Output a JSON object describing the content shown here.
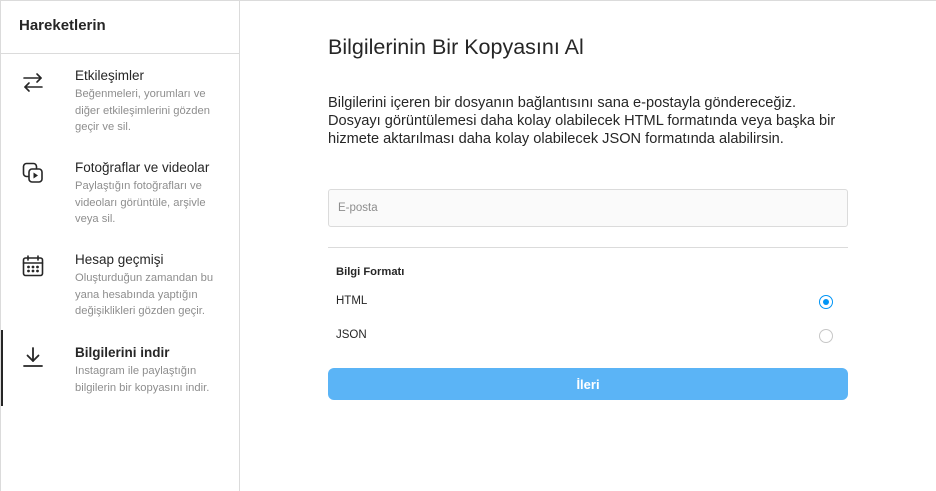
{
  "sidebar": {
    "title": "Hareketlerin",
    "items": [
      {
        "title": "Etkileşimler",
        "desc": "Beğenmeleri, yorumları ve diğer etkileşimlerini gözden geçir ve sil.",
        "icon": "arrows-swap-icon"
      },
      {
        "title": "Fotoğraflar ve videolar",
        "desc": "Paylaştığın fotoğrafları ve videoları görüntüle, arşivle veya sil.",
        "icon": "photo-video-icon"
      },
      {
        "title": "Hesap geçmişi",
        "desc": "Oluşturduğun zamandan bu yana hesabında yaptığın değişiklikleri gözden geçir.",
        "icon": "calendar-icon"
      },
      {
        "title": "Bilgilerini indir",
        "desc": "Instagram ile paylaştığın bilgilerin bir kopyasını indir.",
        "icon": "download-icon",
        "active": true
      }
    ]
  },
  "main": {
    "title": "Bilgilerinin Bir Kopyasını Al",
    "description": "Bilgilerini içeren bir dosyanın bağlantısını sana e-postayla göndereceğiz. Dosyayı görüntülemesi daha kolay olabilecek HTML formatında veya başka bir hizmete aktarılması daha kolay olabilecek JSON formatında alabilirsin.",
    "email": {
      "placeholder": "E-posta",
      "value": ""
    },
    "format": {
      "label": "Bilgi Formatı",
      "options": [
        {
          "label": "HTML",
          "selected": true
        },
        {
          "label": "JSON",
          "selected": false
        }
      ]
    },
    "next_label": "İleri"
  },
  "colors": {
    "accent": "#0095f6",
    "button": "#5bb4f6",
    "border": "#dbdbdb",
    "muted_text": "#8e8e8e"
  }
}
